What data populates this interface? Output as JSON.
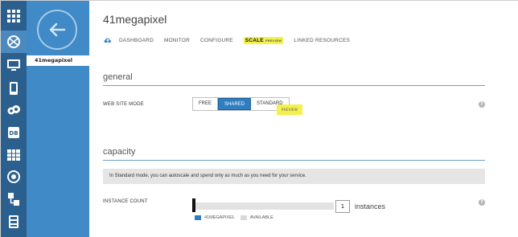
{
  "site": {
    "name": "41megapixel"
  },
  "sidebar": {
    "icons": [
      "grid-icon",
      "globe-icon",
      "monitor-icon",
      "mobile-icon",
      "gear-cloud-icon",
      "database-icon",
      "table-icon",
      "media-icon",
      "network-icon",
      "storage-icon"
    ],
    "items": [
      {
        "label": "41megapixel"
      }
    ]
  },
  "header": {
    "title": "41megapixel",
    "tabs": [
      {
        "label": "DASHBOARD"
      },
      {
        "label": "MONITOR"
      },
      {
        "label": "CONFIGURE"
      },
      {
        "label": "SCALE",
        "badge": "PREVIEW",
        "active": true
      },
      {
        "label": "LINKED RESOURCES"
      }
    ]
  },
  "general": {
    "title": "general",
    "mode_label": "WEB SITE MODE",
    "options": [
      {
        "label": "FREE"
      },
      {
        "label": "SHARED",
        "selected": true
      },
      {
        "label": "STANDARD"
      }
    ],
    "preview_tag": "PREVIEW"
  },
  "capacity": {
    "title": "capacity",
    "info": "In Standard mode, you can autoscale and spend only as much as you need for your service.",
    "instance_label": "INSTANCE COUNT",
    "instance_value": "1",
    "instance_unit": "instances",
    "legend": [
      {
        "label": "41MEGAPIXEL",
        "color": "#2f7ec1"
      },
      {
        "label": "AVAILABLE",
        "color": "#d9d9d9"
      }
    ]
  },
  "colors": {
    "rail": "#2b5f8e",
    "panel": "#3f8ac7",
    "accent": "#2f7ec1",
    "highlight": "#f4f04d"
  }
}
